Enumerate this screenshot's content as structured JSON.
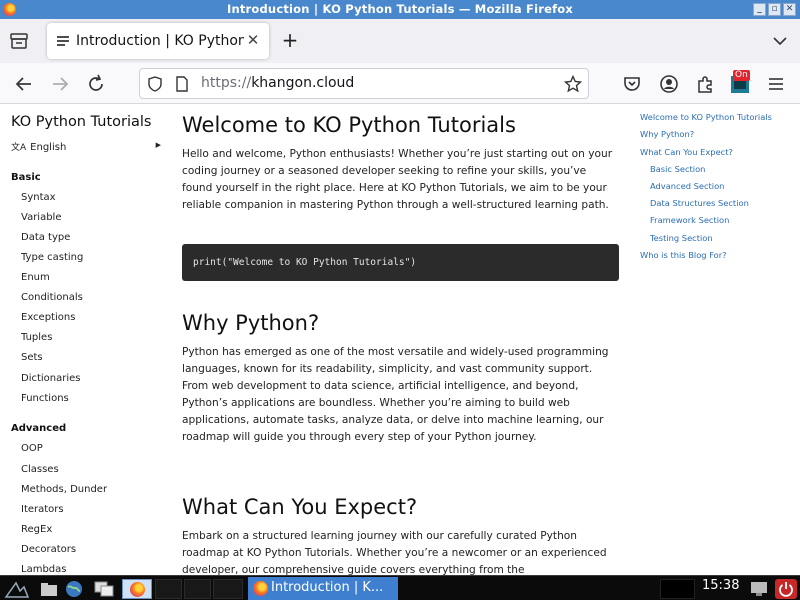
{
  "window": {
    "title": "Introduction | KO Python Tutorials — Mozilla Firefox"
  },
  "tabs": [
    {
      "title": "Introduction | KO Python Tutorials",
      "active": true
    }
  ],
  "navbar": {
    "url_scheme": "https://",
    "url_host": "khangon.cloud",
    "extension_badge": "On"
  },
  "sidebar": {
    "site_title": "KO Python Tutorials",
    "language": "English",
    "sections": [
      {
        "title": "Basic",
        "items": [
          "Syntax",
          "Variable",
          "Data type",
          "Type casting",
          "Enum",
          "Conditionals",
          "Exceptions",
          "Tuples",
          "Sets",
          "Dictionaries",
          "Functions"
        ]
      },
      {
        "title": "Advanced",
        "items": [
          "OOP",
          "Classes",
          "Methods, Dunder",
          "Iterators",
          "RegEx",
          "Decorators",
          "Lambdas"
        ]
      }
    ]
  },
  "main": {
    "h1": "Welcome to KO Python Tutorials",
    "intro": "Hello and welcome, Python enthusiasts! Whether you’re just starting out on your coding journey or a seasoned developer seeking to refine your skills, you’ve found yourself in the right place. Here at KO Python Tutorials, we aim to be your reliable companion in mastering Python through a well-structured learning path.",
    "code": "print(\"Welcome to KO Python Tutorials\")",
    "h2_why": "Why Python?",
    "why_text": "Python has emerged as one of the most versatile and widely-used programming languages, known for its readability, simplicity, and vast community support. From web development to data science, artificial intelligence, and beyond, Python’s applications are boundless. Whether you’re aiming to build web applications, automate tasks, analyze data, or delve into machine learning, our roadmap will guide you through every step of your Python journey.",
    "h2_expect": "What Can You Expect?",
    "expect_text": "Embark on a structured learning journey with our carefully curated Python roadmap at KO Python Tutorials. Whether you’re a newcomer or an experienced developer, our comprehensive guide covers everything from the"
  },
  "toc": {
    "items": [
      {
        "label": "Welcome to KO Python Tutorials",
        "level": 1
      },
      {
        "label": "Why Python?",
        "level": 1
      },
      {
        "label": "What Can You Expect?",
        "level": 1
      },
      {
        "label": "Basic Section",
        "level": 2
      },
      {
        "label": "Advanced Section",
        "level": 2
      },
      {
        "label": "Data Structures Section",
        "level": 2
      },
      {
        "label": "Framework Section",
        "level": 2
      },
      {
        "label": "Testing Section",
        "level": 2
      },
      {
        "label": "Who is this Blog For?",
        "level": 1
      }
    ]
  },
  "taskbar": {
    "active_task": "Introduction | K...",
    "clock": "15:38"
  },
  "icons": {
    "window": [
      "firefox-icon",
      "minimize-icon",
      "maximize-icon",
      "close-icon"
    ],
    "toolbar": [
      "back-arrow-icon",
      "forward-arrow-icon",
      "reload-icon",
      "shield-icon",
      "page-icon",
      "bookmark-star-icon",
      "pocket-icon",
      "account-icon",
      "extensions-icon",
      "menu-icon"
    ]
  },
  "colors": {
    "titlebar": "#4a88cd",
    "link": "#2a6db3",
    "code_bg": "#2b2b2b",
    "taskbar_active": "#3f7fcf"
  }
}
